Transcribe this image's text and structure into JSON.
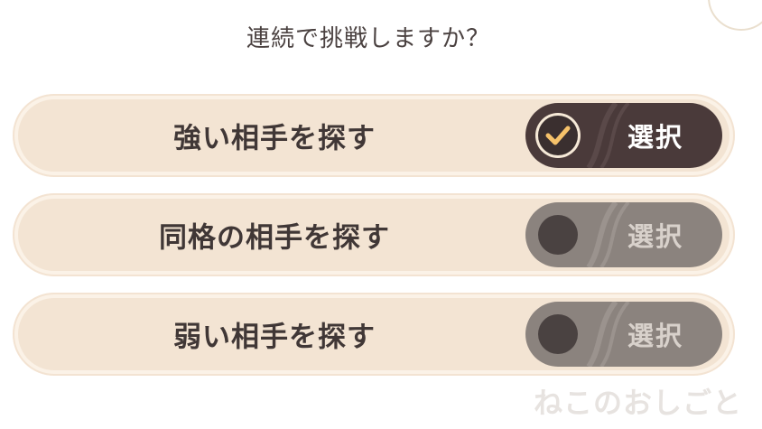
{
  "prompt": {
    "title": "連続で挑戦しますか？"
  },
  "options": [
    {
      "label": "強い相手を探す",
      "toggle_label": "選択",
      "selected": true
    },
    {
      "label": "同格の相手を探す",
      "toggle_label": "選択",
      "selected": false
    },
    {
      "label": "弱い相手を探す",
      "toggle_label": "選択",
      "selected": false
    }
  ],
  "watermark": "ねこのおしごと",
  "colors": {
    "background": "#ffffff",
    "option_bg": "#f3e4d3",
    "toggle_on": "#4a3a3a",
    "toggle_off": "#8b837e",
    "check": "#f6c26a"
  },
  "icons": {
    "check": "check-icon"
  }
}
